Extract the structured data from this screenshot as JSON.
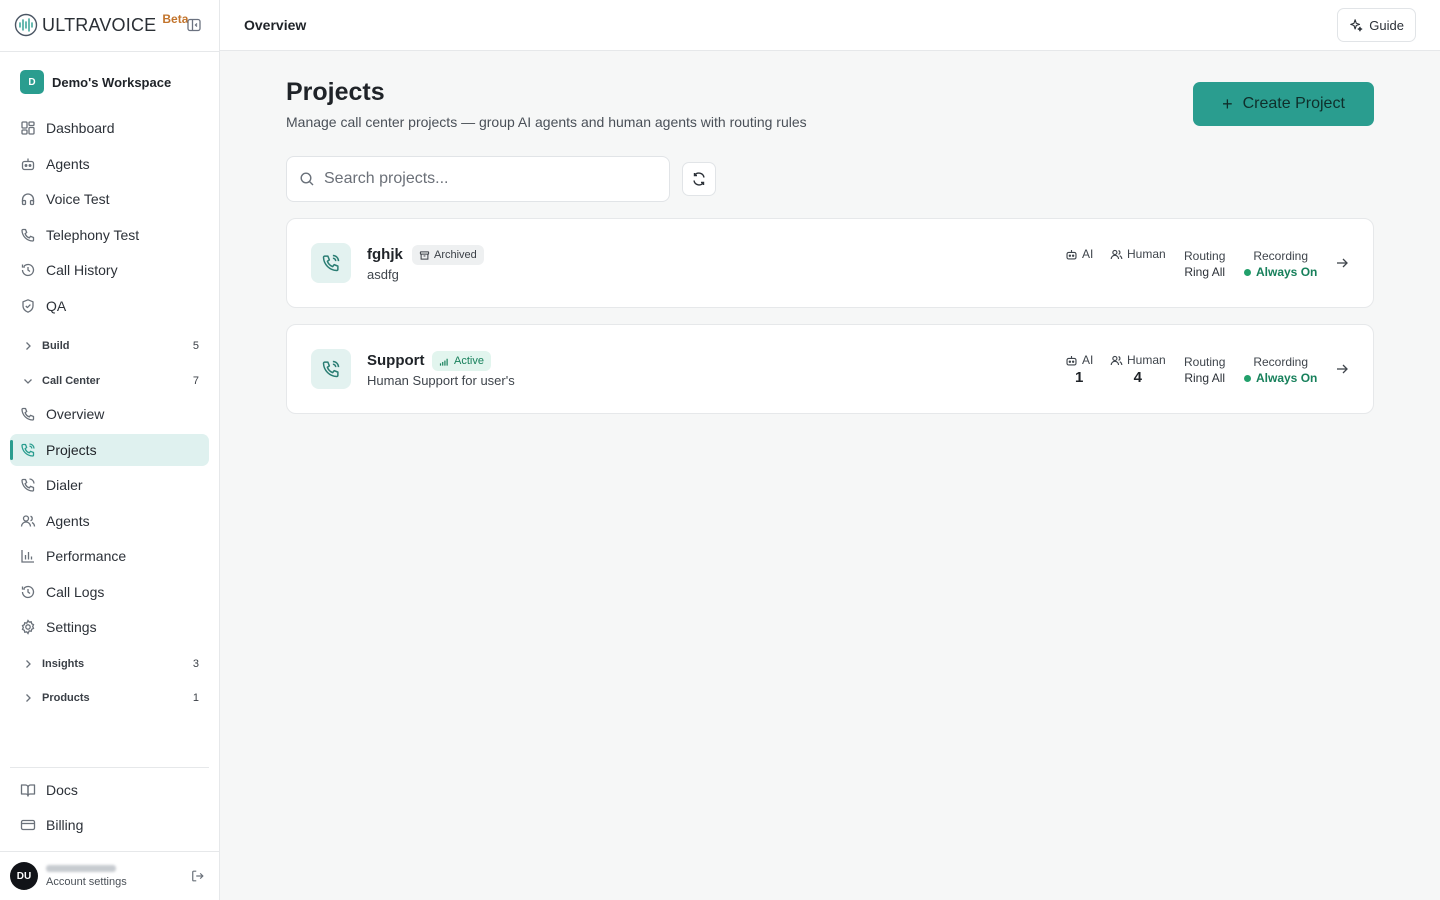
{
  "brand": {
    "name": "ULTRAVOICE",
    "badge": "Beta"
  },
  "workspace": {
    "initial": "D",
    "name": "Demo's Workspace"
  },
  "sidebar": {
    "primary": [
      {
        "label": "Dashboard",
        "icon": "dashboard-icon"
      },
      {
        "label": "Agents",
        "icon": "bot-icon"
      },
      {
        "label": "Voice Test",
        "icon": "headphones-icon"
      },
      {
        "label": "Telephony Test",
        "icon": "phone-icon"
      },
      {
        "label": "Call History",
        "icon": "history-icon"
      },
      {
        "label": "QA",
        "icon": "shield-check-icon"
      }
    ],
    "groups": {
      "build": {
        "label": "Build",
        "count": "5"
      },
      "call_center": {
        "label": "Call Center",
        "count": "7"
      },
      "insights": {
        "label": "Insights",
        "count": "3"
      },
      "products": {
        "label": "Products",
        "count": "1"
      }
    },
    "call_center_items": [
      {
        "label": "Overview",
        "icon": "phone-icon"
      },
      {
        "label": "Projects",
        "icon": "phone-call-icon",
        "active": true
      },
      {
        "label": "Dialer",
        "icon": "phone-outgoing-icon"
      },
      {
        "label": "Agents",
        "icon": "users-icon"
      },
      {
        "label": "Performance",
        "icon": "bar-chart-icon"
      },
      {
        "label": "Call Logs",
        "icon": "history-icon"
      },
      {
        "label": "Settings",
        "icon": "gear-icon"
      }
    ],
    "footer": [
      {
        "label": "Docs",
        "icon": "book-icon"
      },
      {
        "label": "Billing",
        "icon": "credit-card-icon"
      }
    ],
    "user": {
      "initials": "DU",
      "subtitle": "Account settings"
    }
  },
  "header": {
    "breadcrumb": "Overview",
    "guide_label": "Guide"
  },
  "main": {
    "title": "Projects",
    "subtitle": "Manage call center projects — group AI agents and human agents with routing rules",
    "create_label": "Create Project",
    "search_placeholder": "Search projects...",
    "projects": [
      {
        "name": "fghjk",
        "status": "Archived",
        "description": "asdfg",
        "ai_label": "AI",
        "ai_count": "",
        "human_label": "Human",
        "human_count": "",
        "routing_label": "Routing",
        "routing_value": "Ring All",
        "recording_label": "Recording",
        "recording_value": "Always On"
      },
      {
        "name": "Support",
        "status": "Active",
        "description": "Human Support for user's",
        "ai_label": "AI",
        "ai_count": "1",
        "human_label": "Human",
        "human_count": "4",
        "routing_label": "Routing",
        "routing_value": "Ring All",
        "recording_label": "Recording",
        "recording_value": "Always On"
      }
    ]
  },
  "colors": {
    "accent": "#2a9d8f",
    "active_bg": "#dff1ef",
    "status_active": "#17805b",
    "beta": "#c2742c"
  }
}
